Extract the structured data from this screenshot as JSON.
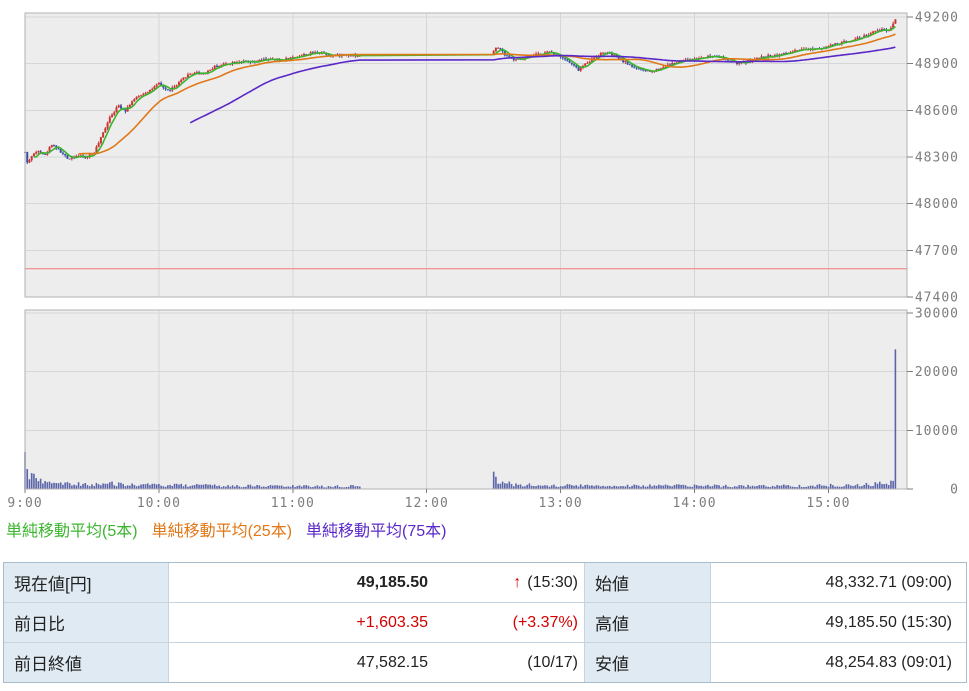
{
  "chart_data": {
    "type": "candlestick+volume",
    "title": "",
    "x_ticks": [
      "9:00",
      "10:00",
      "11:00",
      "12:00",
      "13:00",
      "14:00",
      "15:00"
    ],
    "price_axis": {
      "ticks": [
        49200,
        48900,
        48600,
        48300,
        48000,
        47700,
        47400
      ],
      "min": 47400,
      "max": 49225
    },
    "volume_axis": {
      "ticks": [
        30000,
        20000,
        10000,
        0
      ],
      "max": 30000
    },
    "sessions": [
      [
        0,
        150
      ],
      [
        210,
        390
      ]
    ],
    "open_price": 48332.71,
    "day_high": {
      "price": 49185.5,
      "minute": 390,
      "time": "15:30"
    },
    "day_low": {
      "price": 48254.83,
      "minute": 1,
      "time": "09:01"
    },
    "prev_close_line": 47582.15,
    "price_keypoints": [
      [
        0,
        48330
      ],
      [
        1,
        48262
      ],
      [
        3,
        48305
      ],
      [
        6,
        48345
      ],
      [
        9,
        48310
      ],
      [
        12,
        48385
      ],
      [
        15,
        48345
      ],
      [
        19,
        48290
      ],
      [
        23,
        48310
      ],
      [
        27,
        48295
      ],
      [
        31,
        48330
      ],
      [
        34,
        48420
      ],
      [
        38,
        48560
      ],
      [
        42,
        48630
      ],
      [
        45,
        48600
      ],
      [
        48,
        48660
      ],
      [
        52,
        48700
      ],
      [
        56,
        48730
      ],
      [
        60,
        48770
      ],
      [
        64,
        48725
      ],
      [
        68,
        48760
      ],
      [
        72,
        48820
      ],
      [
        76,
        48845
      ],
      [
        80,
        48835
      ],
      [
        85,
        48880
      ],
      [
        90,
        48900
      ],
      [
        96,
        48915
      ],
      [
        102,
        48905
      ],
      [
        108,
        48930
      ],
      [
        114,
        48920
      ],
      [
        120,
        48940
      ],
      [
        126,
        48960
      ],
      [
        132,
        48975
      ],
      [
        138,
        48950
      ],
      [
        144,
        48960
      ],
      [
        150,
        48950
      ],
      [
        210,
        48985
      ],
      [
        212,
        49005
      ],
      [
        215,
        48960
      ],
      [
        220,
        48920
      ],
      [
        225,
        48940
      ],
      [
        230,
        48960
      ],
      [
        235,
        48975
      ],
      [
        240,
        48950
      ],
      [
        245,
        48895
      ],
      [
        248,
        48860
      ],
      [
        252,
        48910
      ],
      [
        256,
        48950
      ],
      [
        260,
        48975
      ],
      [
        265,
        48945
      ],
      [
        270,
        48900
      ],
      [
        275,
        48862
      ],
      [
        280,
        48850
      ],
      [
        285,
        48872
      ],
      [
        290,
        48900
      ],
      [
        295,
        48918
      ],
      [
        300,
        48930
      ],
      [
        305,
        48945
      ],
      [
        310,
        48950
      ],
      [
        315,
        48920
      ],
      [
        320,
        48900
      ],
      [
        325,
        48920
      ],
      [
        330,
        48940
      ],
      [
        335,
        48952
      ],
      [
        340,
        48962
      ],
      [
        345,
        48980
      ],
      [
        350,
        48990
      ],
      [
        355,
        49000
      ],
      [
        360,
        49012
      ],
      [
        365,
        49030
      ],
      [
        370,
        49052
      ],
      [
        375,
        49072
      ],
      [
        380,
        49100
      ],
      [
        384,
        49122
      ],
      [
        387,
        49112
      ],
      [
        390,
        49185.5
      ]
    ],
    "volume_keypoints": [
      [
        0,
        6300
      ],
      [
        1,
        3400
      ],
      [
        2,
        2200
      ],
      [
        4,
        1800
      ],
      [
        6,
        1500
      ],
      [
        10,
        1200
      ],
      [
        15,
        1000
      ],
      [
        20,
        900
      ],
      [
        30,
        800
      ],
      [
        40,
        900
      ],
      [
        50,
        700
      ],
      [
        60,
        650
      ],
      [
        75,
        600
      ],
      [
        90,
        550
      ],
      [
        105,
        500
      ],
      [
        120,
        480
      ],
      [
        135,
        450
      ],
      [
        150,
        500
      ],
      [
        210,
        2950
      ],
      [
        212,
        1200
      ],
      [
        220,
        700
      ],
      [
        240,
        600
      ],
      [
        260,
        550
      ],
      [
        280,
        600
      ],
      [
        300,
        550
      ],
      [
        320,
        500
      ],
      [
        340,
        550
      ],
      [
        360,
        600
      ],
      [
        375,
        700
      ],
      [
        385,
        900
      ],
      [
        389,
        1200
      ],
      [
        390,
        23800
      ]
    ],
    "volume_specials": {
      "0": 6300,
      "1": 3400,
      "210": 2950,
      "390": 23800
    },
    "ma": [
      {
        "name": "単純移動平均(5本)",
        "period": 5,
        "color": "#3cb52e"
      },
      {
        "name": "単純移動平均(25本)",
        "period": 25,
        "color": "#e07818"
      },
      {
        "name": "単純移動平均(75本)",
        "period": 75,
        "color": "#5a28c8"
      }
    ],
    "colors": {
      "up": "#cc3333",
      "down": "#3b4fa0",
      "volume": "#5a64a8",
      "prev_close": "#f09898",
      "plot_bg": "#ededed",
      "grid": "#d6d6d6",
      "border": "#b2b2b2",
      "axis_text": "#7d7d7d"
    }
  },
  "table": {
    "rows": [
      {
        "label": "現在値[円]",
        "value": "49,185.50",
        "arrow": "↑",
        "aux": "(15:30)",
        "label2": "始値",
        "value2": "48,332.71 (09:00)"
      },
      {
        "label": "前日比",
        "value": "+1,603.35",
        "arrow": "",
        "aux": "(+3.37%)",
        "label2": "高値",
        "value2": "49,185.50 (15:30)"
      },
      {
        "label": "前日終値",
        "value": "47,582.15",
        "arrow": "",
        "aux": "(10/17)",
        "label2": "安値",
        "value2": "48,254.83 (09:01)"
      }
    ]
  }
}
